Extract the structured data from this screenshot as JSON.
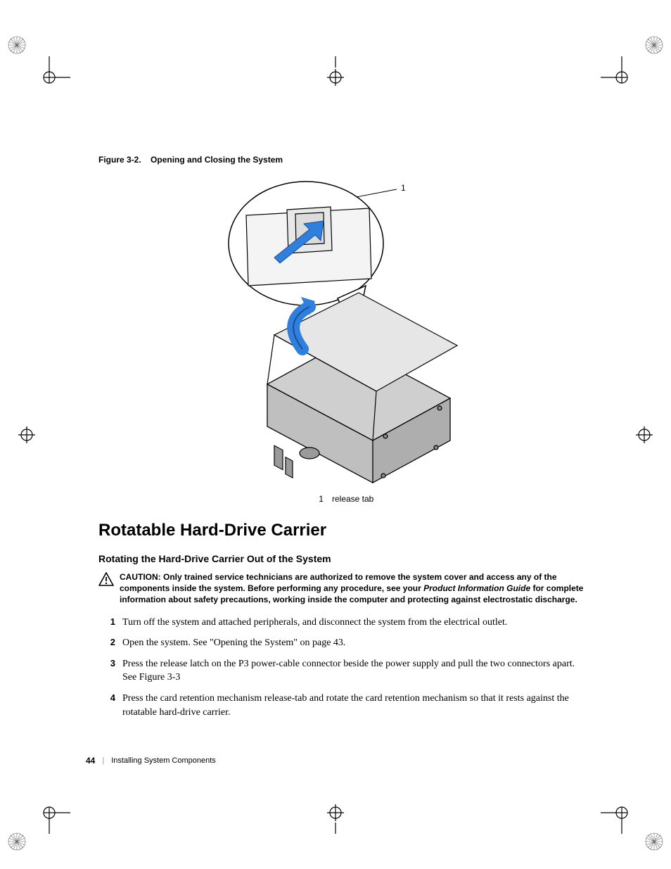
{
  "figure": {
    "caption_prefix": "Figure 3-2.",
    "caption_title": "Opening and Closing the System",
    "callout_1": "1",
    "legend_num": "1",
    "legend_text": "release tab"
  },
  "section_title": "Rotatable Hard-Drive Carrier",
  "subsection_title": "Rotating the Hard-Drive Carrier Out of the System",
  "caution": {
    "label": "CAUTION:",
    "text_before_pig": " Only trained service technicians are authorized to remove the system cover and access any of the components inside the system. Before performing any procedure, see your ",
    "pig": "Product Information Guide",
    "text_after_pig": " for complete information about safety precautions, working inside the computer and protecting against electrostatic discharge."
  },
  "steps": [
    {
      "n": "1",
      "text": "Turn off the system and attached peripherals, and disconnect the system from the electrical outlet."
    },
    {
      "n": "2",
      "text": "Open the system. See \"Opening the System\" on page 43."
    },
    {
      "n": "3",
      "text": "Press the release latch on the P3 power-cable connector beside the power supply and pull the two connectors apart. See Figure 3-3"
    },
    {
      "n": "4",
      "text": "Press the card retention mechanism release-tab and rotate the card retention mechanism so that it rests against the rotatable hard-drive carrier."
    }
  ],
  "footer": {
    "page": "44",
    "separator": "|",
    "chapter": "Installing System Components"
  }
}
